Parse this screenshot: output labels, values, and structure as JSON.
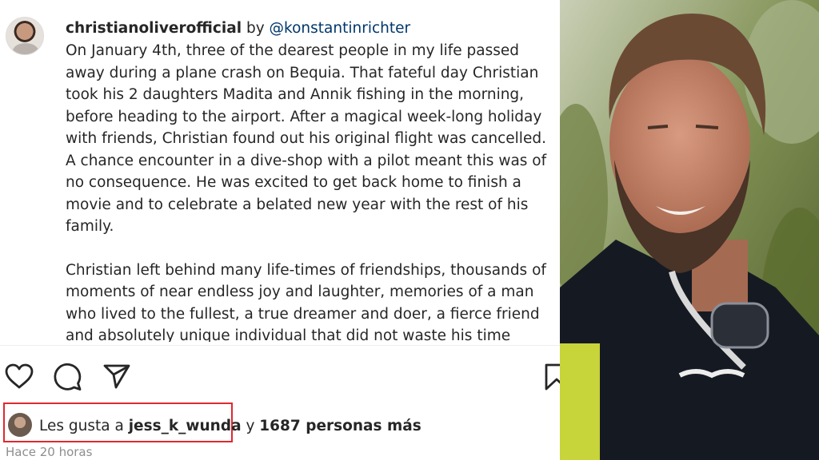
{
  "post": {
    "author": "christianoliverofficial",
    "by_text": "by",
    "mention": "@konstantinrichter",
    "caption_lines_1": [
      "On January 4th, three of the dearest people in my life passed",
      "away during a plane crash on Bequia. That fateful day Christian",
      "took his 2 daughters Madita and Annik fishing in the morning,",
      "before heading to the airport. After a magical week-long holiday",
      "with friends, Christian found out his original flight was cancelled.",
      "A chance encounter in a dive-shop with a pilot meant this was of",
      "no consequence. He was excited to get back home to finish a",
      "movie and to celebrate a belated new year with the rest of his",
      "family."
    ],
    "caption_lines_2": [
      "Christian left behind many life-times of friendships, thousands of",
      "moments of near endless joy and laughter, memories of a man",
      "who lived to the fullest, a true dreamer and doer, a fierce friend",
      "and absolutely unique individual that did not waste his time"
    ]
  },
  "actions": {
    "like_icon": "heart-icon",
    "comment_icon": "speech-bubble-icon",
    "share_icon": "paper-plane-icon",
    "save_icon": "bookmark-icon"
  },
  "likes": {
    "prefix": "Les gusta a ",
    "user": "jess_k_wunda",
    "joiner": " y ",
    "count": "1687 personas más"
  },
  "timestamp": "Hace 20 horas",
  "colors": {
    "text": "#262626",
    "mention": "#00376b",
    "muted": "#8e8e8e",
    "highlight": "#e0282e"
  }
}
